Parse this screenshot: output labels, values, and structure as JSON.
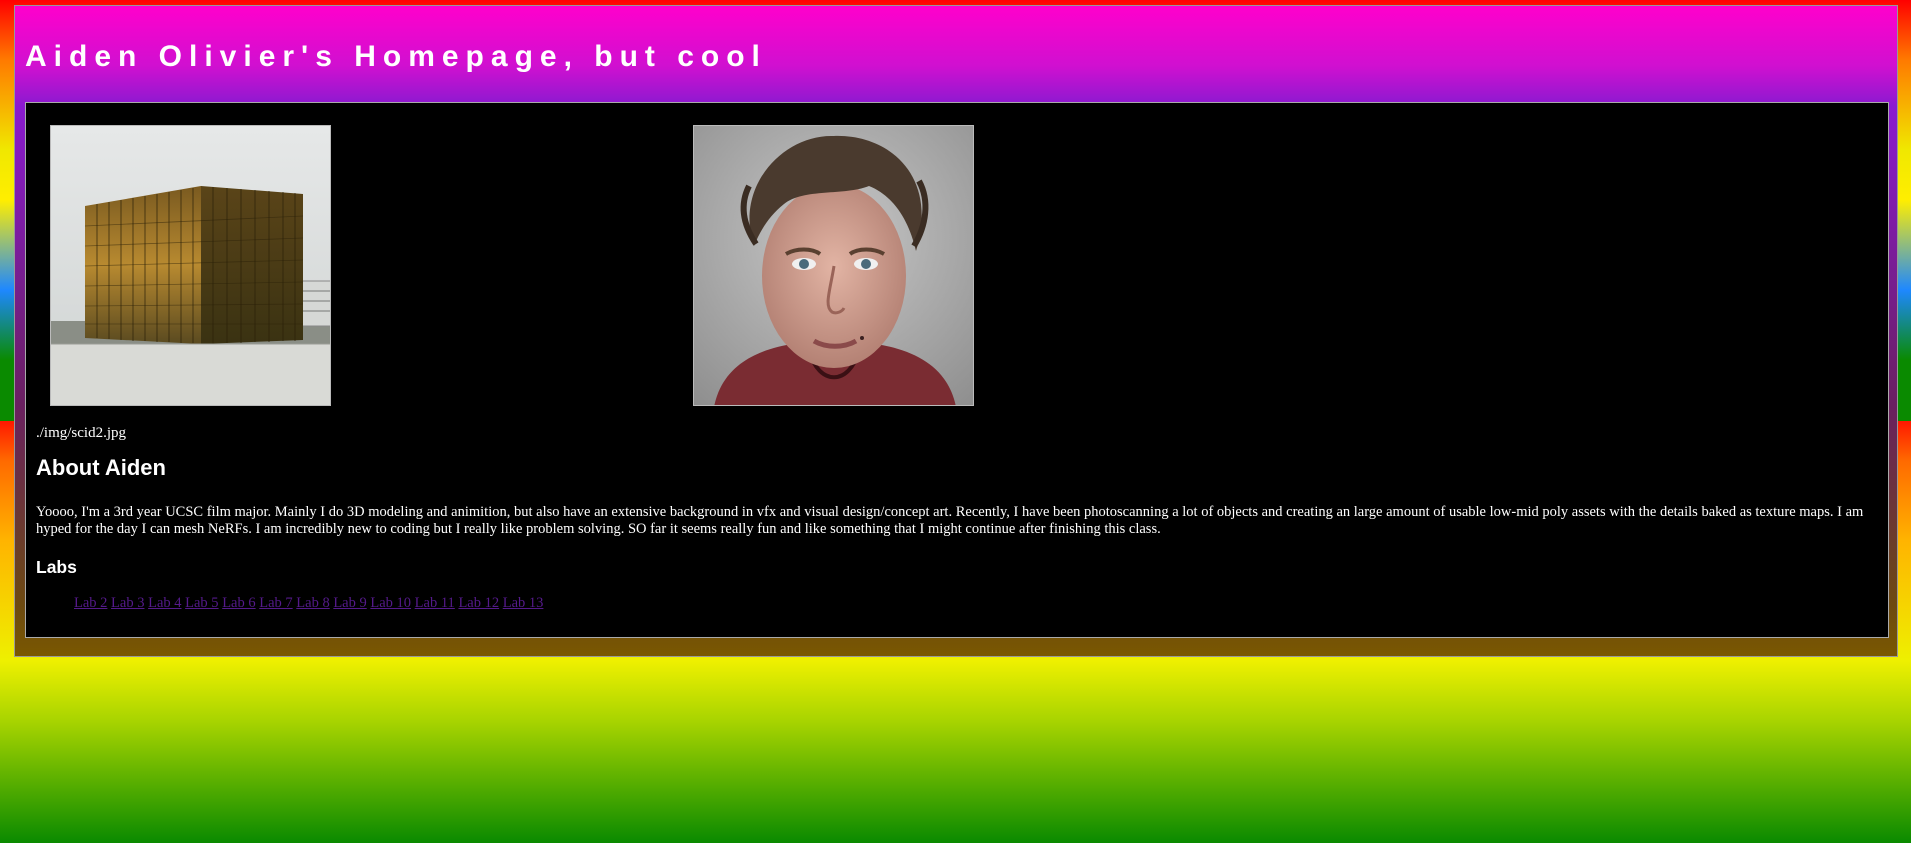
{
  "header": {
    "title": "Aiden Olivier's Homepage, but cool"
  },
  "images": [
    {
      "name": "building-photo",
      "alt": ""
    },
    {
      "name": "portrait-photo",
      "alt": ""
    }
  ],
  "broken_image_caption": "./img/scid2.jpg",
  "about": {
    "heading": "About Aiden",
    "text": "Yoooo, I'm a 3rd year UCSC film major. Mainly I do 3D modeling and animition, but also have an extensive background in vfx and visual design/concept art. Recently, I have been photoscanning a lot of objects and creating an large amount of usable low-mid poly assets with the details baked as texture maps. I am hyped for the day I can mesh NeRFs. I am incredibly new to coding but I really like problem solving. SO far it seems really fun and like something that I might continue after finishing this class."
  },
  "labs": {
    "heading": "Labs",
    "links": [
      "Lab 2",
      "Lab 3",
      "Lab 4",
      "Lab 5",
      "Lab 6",
      "Lab 7",
      "Lab 8",
      "Lab 9",
      "Lab 10",
      "Lab 11",
      "Lab 12",
      "Lab 13"
    ]
  },
  "colors": {
    "link_visited": "#551a8b",
    "content_bg": "#000000",
    "title_text": "#ffffff"
  }
}
